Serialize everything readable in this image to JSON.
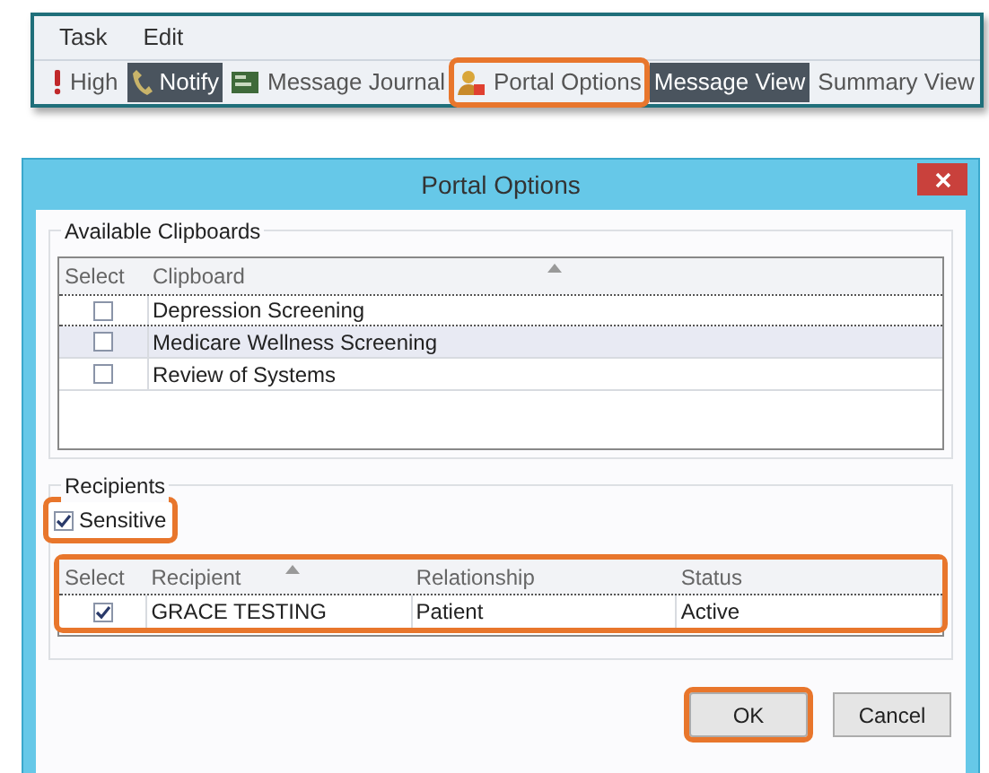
{
  "menu": [
    "Task",
    "Edit"
  ],
  "toolbar": [
    {
      "label": "High",
      "kind": "priority",
      "selected": false,
      "highlighted": false
    },
    {
      "label": "Notify",
      "kind": "notify",
      "selected": true,
      "highlighted": false
    },
    {
      "label": "Message Journal",
      "kind": "journal",
      "selected": false,
      "highlighted": false
    },
    {
      "label": "Portal Options",
      "kind": "portal",
      "selected": false,
      "highlighted": true
    },
    {
      "label": "Message View",
      "kind": "view",
      "selected": true,
      "highlighted": false
    },
    {
      "label": "Summary View",
      "kind": "view",
      "selected": false,
      "highlighted": false
    }
  ],
  "dialog": {
    "title": "Portal Options",
    "clipboards": {
      "legend": "Available Clipboards",
      "columns": [
        "Select",
        "Clipboard"
      ],
      "rows": [
        {
          "name": "Depression Screening",
          "checked": false,
          "selected": false,
          "focused": true
        },
        {
          "name": "Medicare Wellness Screening",
          "checked": false,
          "selected": true,
          "focused": false
        },
        {
          "name": "Review of Systems",
          "checked": false,
          "selected": false,
          "focused": false
        }
      ]
    },
    "recipients": {
      "legend": "Recipients",
      "sensitive": {
        "label": "Sensitive",
        "checked": true,
        "highlighted": true
      },
      "highlighted": true,
      "select_column": "Select",
      "columns": [
        "Recipient",
        "Relationship",
        "Status"
      ],
      "rows": [
        {
          "checked": true,
          "cells": [
            "GRACE TESTING",
            "Patient",
            "Active"
          ]
        }
      ]
    },
    "buttons": [
      {
        "label": "OK",
        "highlighted": true
      },
      {
        "label": "Cancel",
        "highlighted": false
      }
    ]
  }
}
